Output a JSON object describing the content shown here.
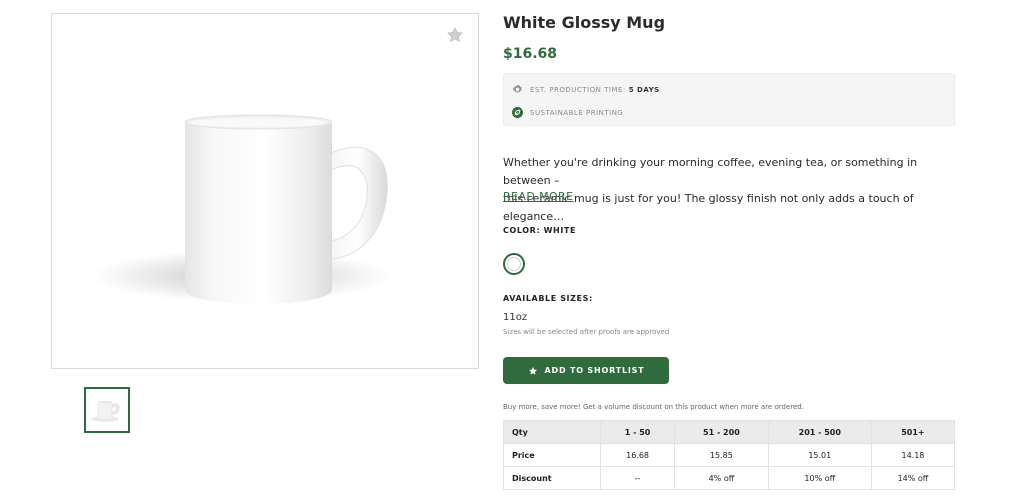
{
  "product": {
    "title": "White Glossy Mug",
    "price": "$16.68",
    "production_time_label": "EST. PRODUCTION TIME:",
    "production_time_value": "5 DAYS",
    "sustainable_label": "SUSTAINABLE PRINTING",
    "description_line1": "Whether you're drinking your morning coffee, evening tea, or something in between –",
    "description_line2": "this ceramic mug is just for you! The glossy finish not only adds a touch of elegance…",
    "read_more": "READ MORE",
    "color_label": "COLOR: WHITE",
    "sizes_label": "AVAILABLE SIZES:",
    "size_value": "11oz",
    "sizes_note": "Sizes will be selected after proofs are approved",
    "shortlist_button": "ADD TO SHORTLIST",
    "bulk_note": "Buy more, save more! Get a volume discount on this product when more are ordered."
  },
  "volume_table": {
    "header": [
      "Qty",
      "1 - 50",
      "51 - 200",
      "201 - 500",
      "501+"
    ],
    "rows": [
      [
        "Price",
        "16.68",
        "15.85",
        "15.01",
        "14.18"
      ],
      [
        "Discount",
        "--",
        "4% off",
        "10% off",
        "14% off"
      ]
    ]
  },
  "colors": {
    "accent": "#2f6b3c",
    "info_bg": "#f5f5f5",
    "table_header_bg": "#ebebeb"
  },
  "icons": {
    "favorite": "star-icon",
    "production": "gear-icon",
    "sustainable": "leaf-icon",
    "shortlist": "star-icon"
  }
}
